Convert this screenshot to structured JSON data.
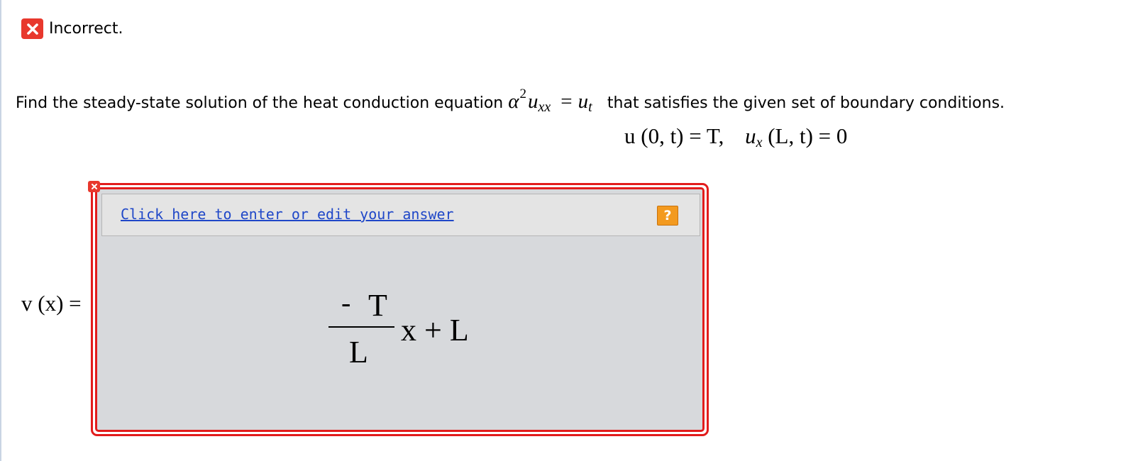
{
  "status": {
    "icon": "close-icon",
    "text": "Incorrect.",
    "color": "#e8382d"
  },
  "question": {
    "text": "Find the steady-state solution of the heat conduction equation",
    "equation": {
      "alpha": "α",
      "alpha_exp": "2",
      "u_left": "u",
      "u_left_sub": "xx",
      "equals": "=",
      "u_right": "u",
      "u_right_sub": "t"
    },
    "text_after": "that satisfies the given set of boundary conditions."
  },
  "boundary_conditions": {
    "first": "u (0, t) = T,",
    "second_u": "u",
    "second_sub": "x",
    "second_rest": "(L, t) = 0"
  },
  "answer_label": "v (x) =",
  "answer_box": {
    "edit_link": "Click here to enter or edit your answer",
    "help_label": "?",
    "help_icon": "help-icon",
    "border_color": "#e21c1c",
    "expression": {
      "minus": "-",
      "numerator": "T",
      "denominator": "L",
      "rest": "x + L"
    }
  }
}
